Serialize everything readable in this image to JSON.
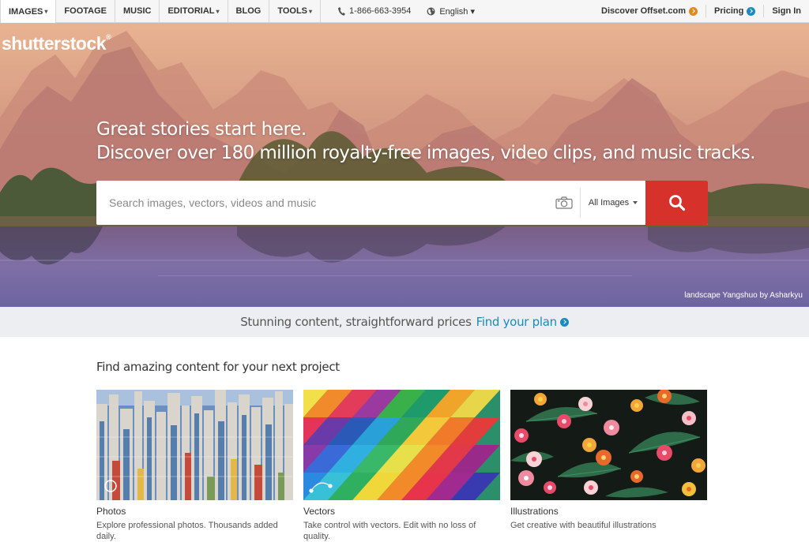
{
  "topnav": {
    "items": [
      {
        "label": "IMAGES",
        "caret": "▾",
        "active": true
      },
      {
        "label": "FOOTAGE",
        "caret": ""
      },
      {
        "label": "MUSIC",
        "caret": ""
      },
      {
        "label": "EDITORIAL",
        "caret": "▾"
      },
      {
        "label": "BLOG",
        "caret": ""
      },
      {
        "label": "TOOLS",
        "caret": "▾"
      }
    ],
    "phone": "1-866-663-3954",
    "phone_icon": "phone-icon",
    "language": "English ▾",
    "language_icon": "globe-icon",
    "offset_label": "Discover Offset.com",
    "pricing_label": "Pricing",
    "signin_label": "Sign In",
    "colors": {
      "offset": "#e08a1e",
      "pricing": "#1a8bbf"
    }
  },
  "hero": {
    "logo": "shutterstock",
    "logo_mark": "®",
    "headline": "Great stories start here.",
    "subheadline": "Discover over 180 million royalty-free images, video clips, and music tracks.",
    "search": {
      "placeholder": "Search images, vectors, videos and music",
      "value": "",
      "camera_icon": "camera-icon",
      "type_selected": "All Images",
      "button_icon": "search-icon"
    },
    "credit": "landscape Yangshuo by Asharkyu"
  },
  "banner": {
    "text": "Stunning content, straightforward prices",
    "link": "Find your plan",
    "link_color": "#1a8bbf"
  },
  "content": {
    "title": "Find amazing content for your next project",
    "cards": [
      {
        "title": "Photos",
        "description": "Explore professional photos. Thousands added daily."
      },
      {
        "title": "Vectors",
        "description": "Take control with vectors. Edit with no loss of quality."
      },
      {
        "title": "Illustrations",
        "description": "Get creative with beautiful illustrations"
      }
    ]
  },
  "colors": {
    "accent_red": "#d6322b",
    "link_blue": "#1a8bbf"
  }
}
